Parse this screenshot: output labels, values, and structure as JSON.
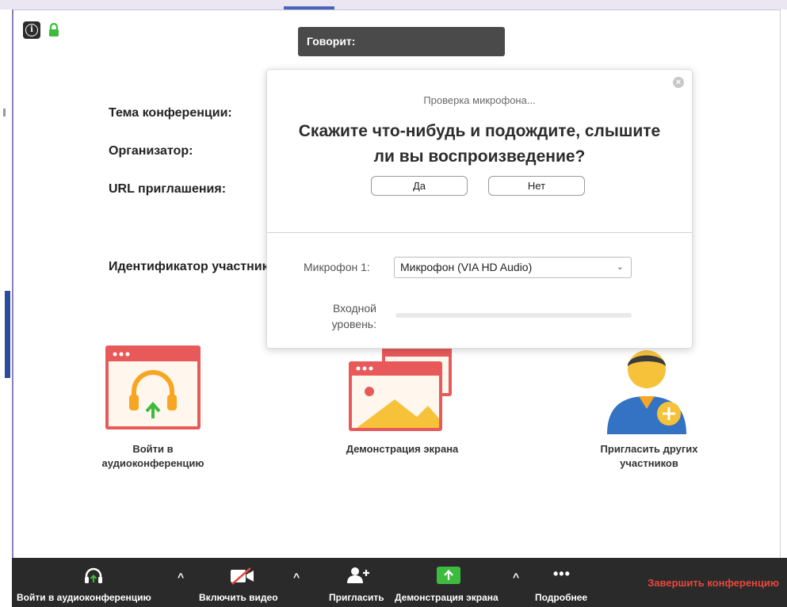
{
  "header": {
    "speaking_label": "Говорит:"
  },
  "meeting_info": {
    "topic_label": "Тема конференции:",
    "host_label": "Организатор:",
    "url_label": "URL приглашения:",
    "participant_id_label": "Идентификатор участника:"
  },
  "mic_dialog": {
    "status": "Проверка микрофона...",
    "question_line1": "Скажите что-нибудь и подождите, слышите",
    "question_line2": "ли вы воспроизведение?",
    "yes_label": "Да",
    "no_label": "Нет",
    "mic_label": "Микрофон 1:",
    "mic_selected": "Микрофон (VIA HD Audio)",
    "level_label_line1": "Входной",
    "level_label_line2": "уровень:",
    "input_level_fraction": 0
  },
  "tiles": {
    "audio_line1": "Войти в",
    "audio_line2": "аудиоконференцию",
    "share": "Демонстрация экрана",
    "invite_line1": "Пригласить других",
    "invite_line2": "участников"
  },
  "toolbar": {
    "join_audio": "Войти в аудиоконференцию",
    "start_video": "Включить видео",
    "invite": "Пригласить",
    "share_screen": "Демонстрация экрана",
    "more": "Подробнее",
    "end_meeting": "Завершить конференцию"
  },
  "colors": {
    "end_red": "#e5483c",
    "share_green": "#3dbb3d",
    "tile_red": "#e85a5a",
    "headphone_orange": "#f6a623"
  },
  "icons": [
    "info-icon",
    "lock-icon",
    "close-icon",
    "chevron-down-icon",
    "headphones-icon",
    "screen-share-icon",
    "invite-person-icon",
    "video-off-icon",
    "more-icon"
  ]
}
